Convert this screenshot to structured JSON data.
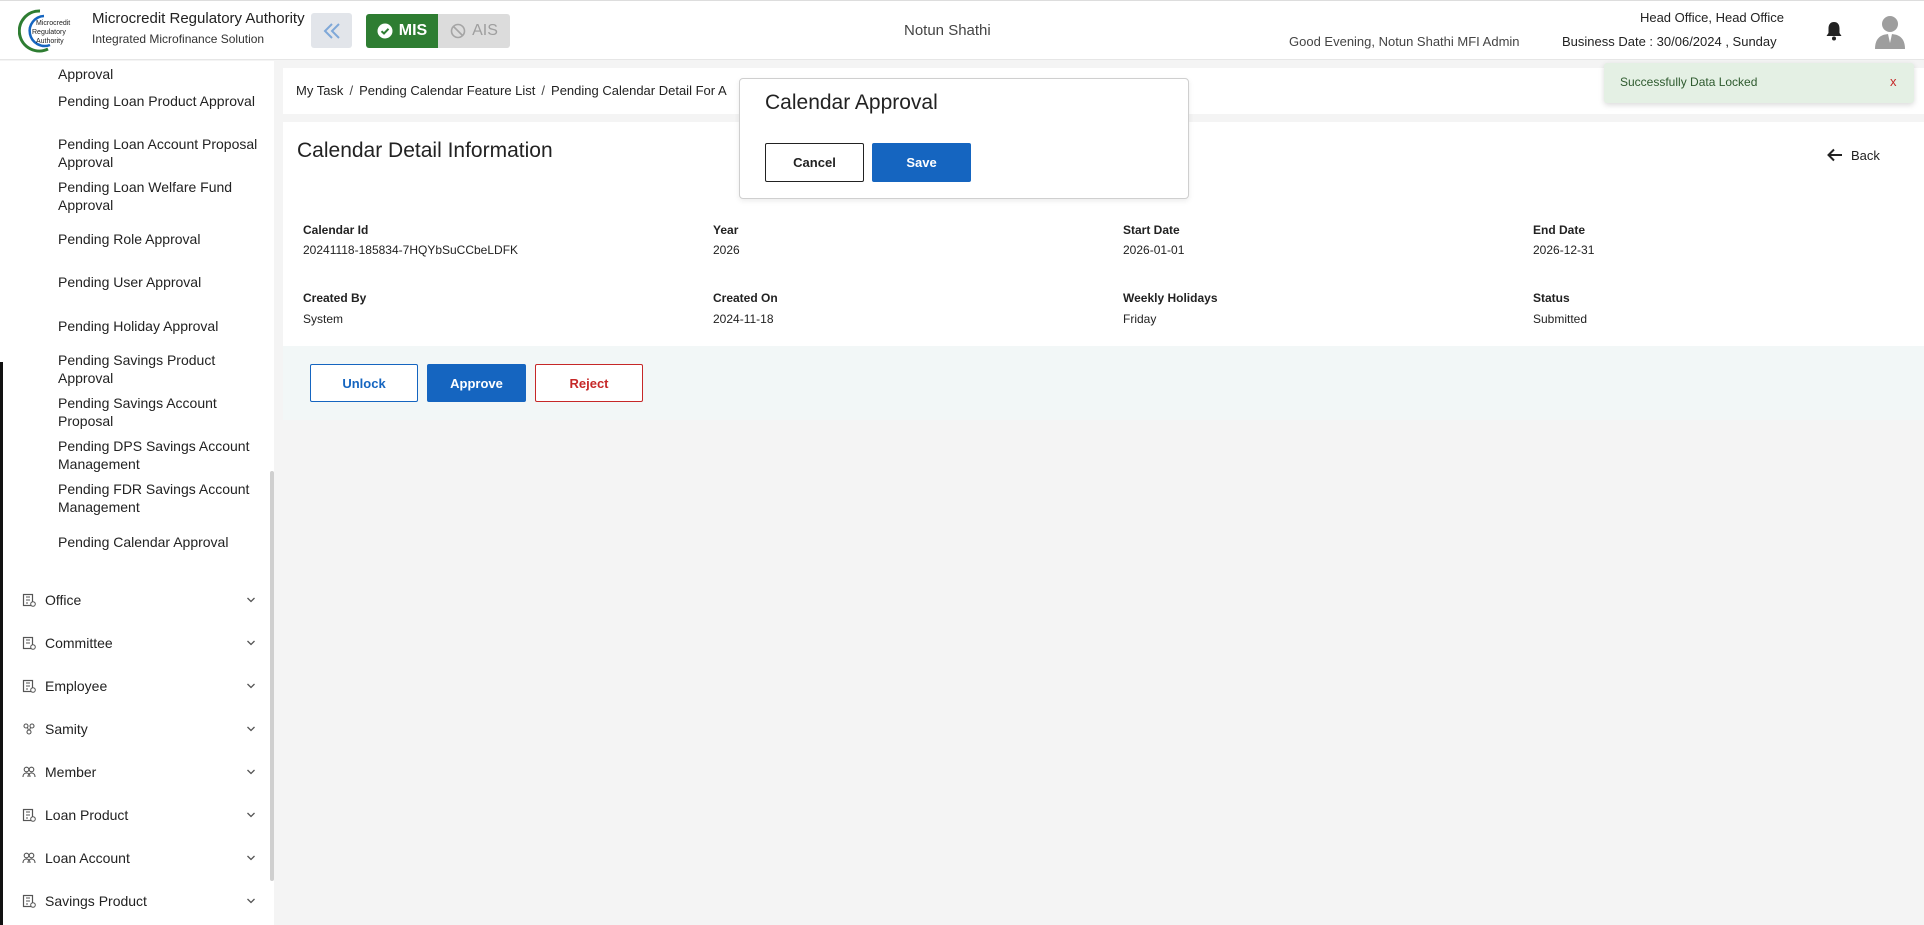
{
  "header": {
    "brand_title": "Microcredit Regulatory Authority",
    "brand_sub": "Integrated Microfinance Solution",
    "logo_text": [
      "Microcredit",
      "Regulatory",
      "Authority"
    ],
    "mode_active": "MIS",
    "mode_inactive": "AIS",
    "org_name": "Notun Shathi",
    "greeting": "Good Evening, Notun Shathi MFI Admin",
    "office": "Head Office, Head Office",
    "business_date": "Business Date : 30/06/2024 , Sunday"
  },
  "sidebar": {
    "sub_items": [
      "Approval",
      "Pending Loan Product Approval",
      "Pending Loan Account Proposal Approval",
      "Pending Loan Welfare Fund Approval",
      "Pending Role Approval",
      "Pending User Approval",
      "Pending Holiday Approval",
      "Pending Savings Product Approval",
      "Pending Savings Account Proposal",
      "Pending DPS Savings Account Management",
      "Pending FDR Savings Account Management",
      "Pending Calendar Approval"
    ],
    "main_items": [
      {
        "label": "Office",
        "icon": "office-icon"
      },
      {
        "label": "Committee",
        "icon": "committee-icon"
      },
      {
        "label": "Employee",
        "icon": "employee-icon"
      },
      {
        "label": "Samity",
        "icon": "samity-icon"
      },
      {
        "label": "Member",
        "icon": "member-icon"
      },
      {
        "label": "Loan Product",
        "icon": "loan-product-icon"
      },
      {
        "label": "Loan Account",
        "icon": "loan-account-icon"
      },
      {
        "label": "Savings Product",
        "icon": "savings-product-icon"
      }
    ]
  },
  "breadcrumb": [
    "My Task",
    "Pending Calendar Feature List",
    "Pending Calendar Detail For A"
  ],
  "page": {
    "title": "Calendar Detail Information",
    "back_label": "Back"
  },
  "details": {
    "calendar_id_label": "Calendar Id",
    "calendar_id": "20241118-185834-7HQYbSuCCbeLDFK",
    "year_label": "Year",
    "year": "2026",
    "start_date_label": "Start Date",
    "start_date": "2026-01-01",
    "end_date_label": "End Date",
    "end_date": "2026-12-31",
    "created_by_label": "Created By",
    "created_by": "System",
    "created_on_label": "Created On",
    "created_on": "2024-11-18",
    "weekly_holidays_label": "Weekly Holidays",
    "weekly_holidays": "Friday",
    "status_label": "Status",
    "status": "Submitted"
  },
  "actions": {
    "unlock": "Unlock",
    "approve": "Approve",
    "reject": "Reject"
  },
  "modal": {
    "title": "Calendar Approval",
    "cancel": "Cancel",
    "save": "Save"
  },
  "toast": {
    "message": "Successfully Data Locked",
    "close": "x"
  },
  "colors": {
    "primary": "#1565c0",
    "mis_green": "#2e7d32",
    "danger": "#c62828",
    "toast_bg": "#e4f0e4"
  }
}
